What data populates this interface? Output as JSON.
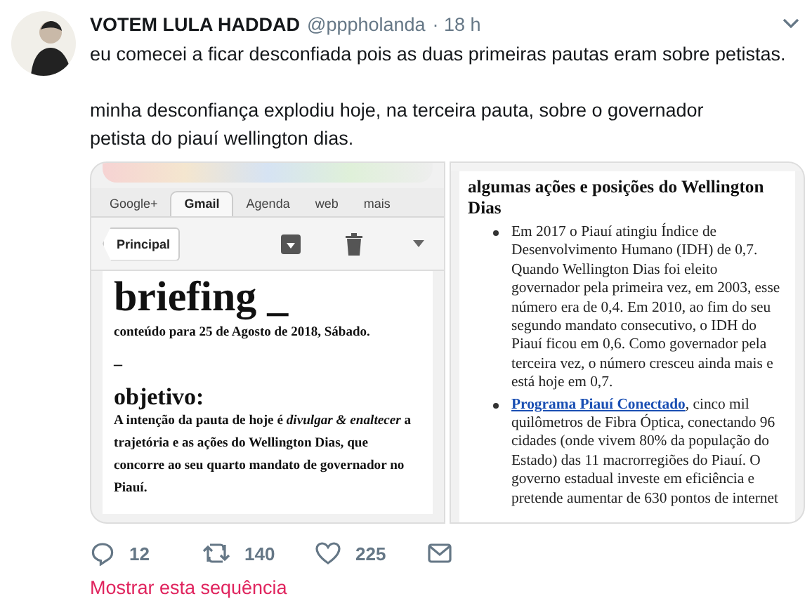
{
  "tweet": {
    "author_name": "VOTEM LULA HADDAD",
    "handle": "@pppholanda",
    "time": "· 18 h",
    "paragraphs": [
      "eu comecei a ficar desconfiada pois as duas primeiras pautas eram sobre petistas.",
      "minha desconfiança explodiu hoje, na terceira pauta, sobre o governador petista do piauí wellington dias."
    ],
    "media": [
      {
        "kind": "email",
        "tabs": [
          {
            "label": "Google+",
            "selected": false
          },
          {
            "label": "Gmail",
            "selected": true
          },
          {
            "label": "Agenda",
            "selected": false
          },
          {
            "label": "web",
            "selected": false
          },
          {
            "label": "mais",
            "selected": false
          }
        ],
        "back_button": "Principal",
        "heading": "briefing _",
        "date": "conteúdo para 25 de Agosto de 2018, Sábado.",
        "separator": "_",
        "section_title": "objetivo:",
        "body": "A intenção da pauta de hoje é *divulgar & enaltecer* a trajetória e as ações do Wellington Dias, que concorre ao seu quarto mandato de governador no Piauí."
      },
      {
        "kind": "document",
        "heading": "algumas ações e posições do Wellington Dias",
        "bullets": [
          {
            "text": "Em 2017 o Piauí atingiu Índice de Desenvolvimento Humano (IDH) de 0,7. Quando Wellington Dias foi eleito governador pela primeira vez, em 2003, esse número era de 0,4. Em 2010, ao fim do seu segundo mandato consecutivo, o IDH do Piauí ficou em 0,6. Como governador pela terceira vez, o número cresceu ainda mais e está hoje em 0,7."
          },
          {
            "link": "Programa Piauí Conectado",
            "text": ", cinco mil quilômetros de Fibra Óptica, conectando 96 cidades (onde vivem 80% da população do Estado) das 11 macrorregiões do Piauí. O governo estadual investe em eficiência e pretende aumentar de 630 pontos de internet"
          }
        ]
      }
    ],
    "actions": [
      {
        "kind": "reply",
        "count": "12"
      },
      {
        "kind": "retweet",
        "count": "140"
      },
      {
        "kind": "like",
        "count": "225"
      },
      {
        "kind": "message"
      }
    ],
    "thread_link": "Mostrar esta sequência"
  }
}
